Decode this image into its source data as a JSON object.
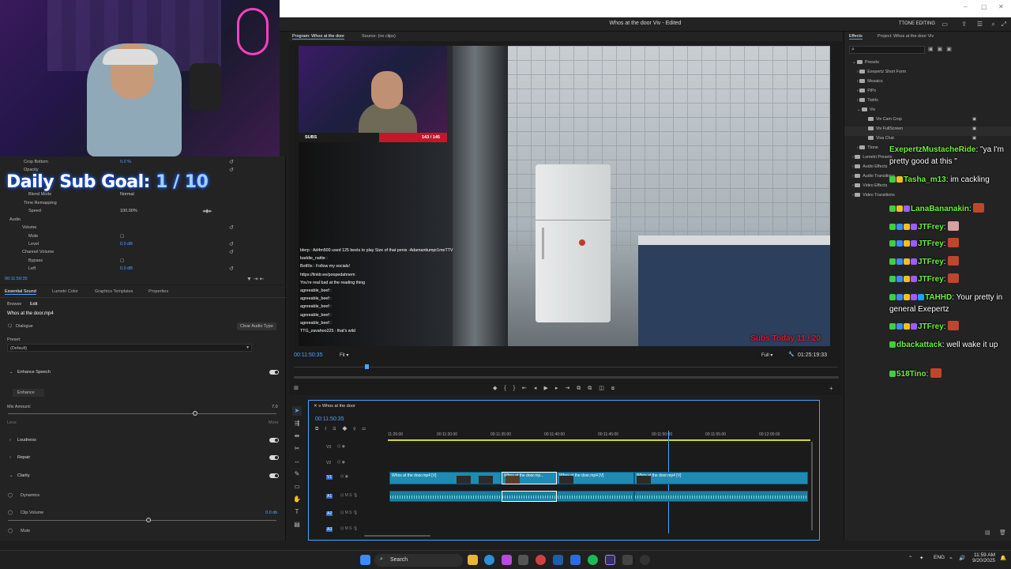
{
  "window": {
    "title": "Whos at the door Viv - Edited",
    "workspace": "TTONE EDITING"
  },
  "webcam": {
    "sub_goal_label": "Daily Sub Goal:",
    "sub_goal_value": "1 / 10"
  },
  "effect_controls": {
    "rows": [
      {
        "label": "Crop Bottom",
        "value": "0.0 %"
      },
      {
        "label": "Opacity",
        "value": ""
      },
      {
        "label": "Blend Mode",
        "value": "Normal"
      },
      {
        "label": "Time Remapping",
        "value": ""
      },
      {
        "label": "Speed",
        "value": "100.00%"
      },
      {
        "label": "Audio",
        "value": ""
      },
      {
        "label": "Volume",
        "value": ""
      },
      {
        "label": "Mute",
        "value": ""
      },
      {
        "label": "Level",
        "value": "0.0 dB"
      },
      {
        "label": "Channel Volume",
        "value": ""
      },
      {
        "label": "Bypass",
        "value": ""
      },
      {
        "label": "Left",
        "value": "0.0 dB"
      }
    ],
    "timecode": "00:11:50:35"
  },
  "essential_sound": {
    "tabs": [
      "Essential Sound",
      "Lumetri Color",
      "Graphics Templates",
      "Properties"
    ],
    "subtabs": [
      "Browse",
      "Edit"
    ],
    "clip_name": "Whos at the door.mp4",
    "type_label": "Dialogue",
    "clear_button": "Clear Audio Type",
    "preset_label": "Preset:",
    "preset_value": "(Default)",
    "enhance_speech": "Enhance Speech",
    "enhance_button": "Enhance",
    "mix_amount": "Mix Amount:",
    "mix_value": "7.0",
    "less": "Less",
    "more": "More",
    "loudness": "Loudness",
    "repair": "Repair",
    "clarity": "Clarity",
    "dynamics": "Dynamics",
    "clip_volume": "Clip Volume",
    "clip_volume_value": "0.0 db",
    "mute": "Mute"
  },
  "program": {
    "tab_program": "Program: Whos at the door",
    "tab_source": "Source: (no clips)",
    "timecode": "00:11:50:35",
    "fit": "Fit",
    "quality": "Full",
    "duration": "01:25:19:33",
    "subs_label": "SUBS",
    "subs_count": "143 / 145",
    "subs_today": "Subs Today 11 / 20",
    "chat_overlay": [
      "blerp : Ad4m500 used 125 beets to play Size of that penis -Adamantiumpr1meTTV",
      "baddie_nattie :",
      "BotRix : Follow my socials!",
      "https://linktr.ee/poopedahnem",
      "You're real bad at the reading thing",
      "agreeable_beef :",
      "agreeable_beef :",
      "agreeable_beef :",
      "agreeable_beef :",
      "agreeable_beef :",
      "TTG_zavahoo225 : that's wild"
    ]
  },
  "effects_panel": {
    "tab_effects": "Effects",
    "tab_project": "Project: Whos at the door Viv",
    "tree": [
      {
        "label": "Presets",
        "depth": 0
      },
      {
        "label": "Exepertz Short Form",
        "depth": 1
      },
      {
        "label": "Mosaics",
        "depth": 1
      },
      {
        "label": "PiPs",
        "depth": 1
      },
      {
        "label": "Twirls",
        "depth": 1
      },
      {
        "label": "Viv",
        "depth": 1
      },
      {
        "label": "Viv Cam Crop",
        "depth": 2
      },
      {
        "label": "Viv FullScreen",
        "depth": 2
      },
      {
        "label": "Viva Chat",
        "depth": 2
      },
      {
        "label": "Ttone",
        "depth": 1
      },
      {
        "label": "Lumetri Presets",
        "depth": 0
      },
      {
        "label": "Audio Effects",
        "depth": 0
      },
      {
        "label": "Audio Transitions",
        "depth": 0
      },
      {
        "label": "Video Effects",
        "depth": 0
      },
      {
        "label": "Video Transitions",
        "depth": 0
      }
    ]
  },
  "chat": [
    {
      "user": "ExepertzMustacheRide",
      "text": ": \"ya I'm pretty good at this \""
    },
    {
      "user": "Tasha_m13",
      "text": ": im cackling"
    },
    {
      "user": "LanaBananakin",
      "text": ":"
    },
    {
      "user": "JTFrey",
      "text": ":"
    },
    {
      "user": "JTFrey",
      "text": ":"
    },
    {
      "user": "JTFrey",
      "text": ":"
    },
    {
      "user": "JTFrey",
      "text": ":"
    },
    {
      "user": "TAHHD",
      "text": ": Your pretty in general Exepertz"
    },
    {
      "user": "JTFrey",
      "text": ":"
    },
    {
      "user": "dbackattack",
      "text": ": well wake it up"
    },
    {
      "user": "518Tino",
      "text": ":"
    }
  ],
  "timeline": {
    "sequence": "Whos at the door",
    "timecode": "00:11:50:35",
    "ruler": [
      "11:25:00",
      "00:11:30:00",
      "00:11:35:00",
      "00:11:40:00",
      "00:11:45:00",
      "00:11:50:00",
      "00:11:55:00",
      "00:12:00:00"
    ],
    "tracks": [
      "V3",
      "V2",
      "V1",
      "A1",
      "A2",
      "A3"
    ],
    "clips": [
      "Whos at the door.mp4 [V]",
      "Whos at the door.mp...",
      "Whos at the door.mp4 [V]",
      "Whos at the door.mp4 [V]"
    ]
  },
  "taskbar": {
    "search": "Search",
    "lang": "ENG",
    "time": "11:59 AM",
    "date": "9/20/2025"
  }
}
